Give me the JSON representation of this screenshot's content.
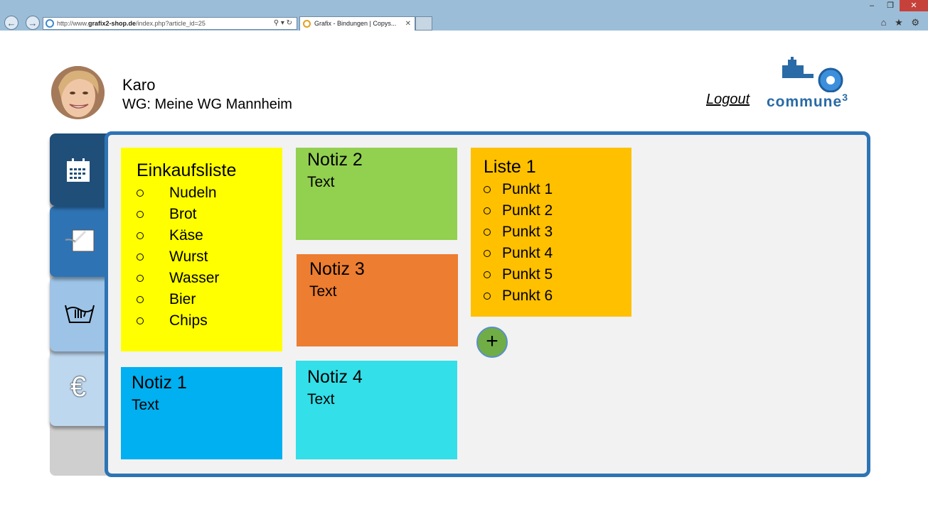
{
  "browser": {
    "url_prefix": "http://www.",
    "url_domain": "grafix2-shop.de",
    "url_path": "/index.php?article_id=25",
    "url_controls": "⚲ ▾ ↻",
    "tab_title": "Grafix - Bindungen | Copys...",
    "tab_close": "✕",
    "back_glyph": "←",
    "forward_glyph": "→",
    "minimize": "–",
    "restore": "❐",
    "close": "✕",
    "right_icons": "⌂ ★ ⚙"
  },
  "header": {
    "user_name": "Karo",
    "wg_label": "WG: Meine WG Mannheim",
    "logout": "Logout",
    "logo_text": "commune",
    "logo_sup": "3"
  },
  "sidebar": {
    "items": [
      {
        "icon": "calendar-icon",
        "color": "#1f4e79"
      },
      {
        "icon": "notes-icon",
        "color": "#2e74b5"
      },
      {
        "icon": "laundry-icon",
        "color": "#9dc3e6"
      },
      {
        "icon": "euro-icon",
        "color": "#bdd7ee",
        "glyph": "€"
      }
    ]
  },
  "notes": {
    "shopping": {
      "title": "Einkaufsliste",
      "color": "#ffff00",
      "items": [
        "Nudeln",
        "Brot",
        "Käse",
        "Wurst",
        "Wasser",
        "Bier",
        "Chips"
      ]
    },
    "note1": {
      "title": "Notiz 1",
      "text": "Text",
      "color": "#00b0f0"
    },
    "note2": {
      "title": "Notiz 2",
      "text": "Text",
      "color": "#92d050"
    },
    "note3": {
      "title": "Notiz 3",
      "text": "Text",
      "color": "#ed7d31"
    },
    "note4": {
      "title": "Notiz 4",
      "text": "Text",
      "color": "#33dfe8"
    },
    "list1": {
      "title": "Liste 1",
      "color": "#ffc000",
      "items": [
        "Punkt 1",
        "Punkt 2",
        "Punkt 3",
        "Punkt 4",
        "Punkt 5",
        "Punkt 6"
      ]
    }
  },
  "add_button": {
    "label": "+",
    "color": "#70ad47"
  }
}
